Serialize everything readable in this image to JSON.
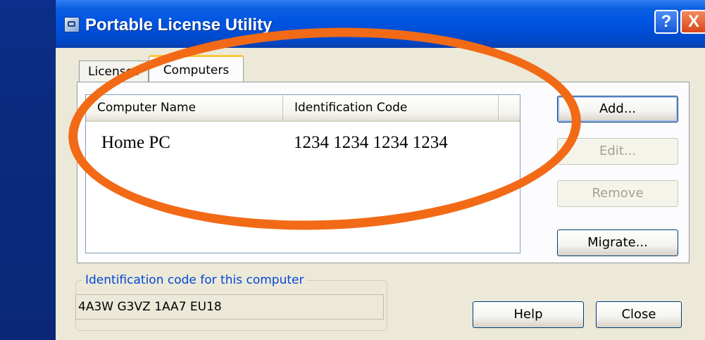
{
  "window": {
    "title": "Portable License Utility",
    "help_glyph": "?",
    "close_glyph": "X"
  },
  "tabs": [
    {
      "label": "Licenses",
      "active": false
    },
    {
      "label": "Computers",
      "active": true
    }
  ],
  "list": {
    "columns": [
      "Computer Name",
      "Identification Code"
    ],
    "rows": [
      {
        "name": "Home PC",
        "code": "1234 1234 1234 1234"
      }
    ]
  },
  "buttons": {
    "add": "Add...",
    "edit": "Edit...",
    "remove": "Remove",
    "migrate": "Migrate...",
    "help": "Help",
    "close": "Close"
  },
  "id_group": {
    "legend": "Identification code for this computer",
    "value": "4A3W G3VZ 1AA7 EU18"
  },
  "colors": {
    "annotation": "#f26a16",
    "titlebar": "#0054e3",
    "tab_highlight": "#ffc83c"
  }
}
